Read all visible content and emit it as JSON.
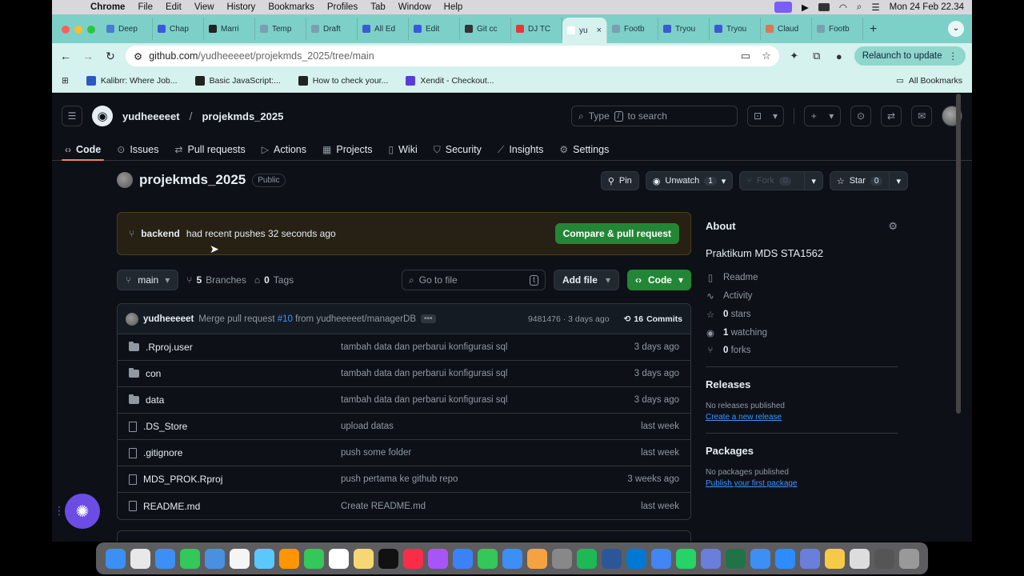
{
  "menubar": {
    "app": "Chrome",
    "items": [
      "File",
      "Edit",
      "View",
      "History",
      "Bookmarks",
      "Profiles",
      "Tab",
      "Window",
      "Help"
    ],
    "clock": "Mon 24 Feb  22.34"
  },
  "tabs": [
    {
      "label": "Deep",
      "color": "#4a7bd5"
    },
    {
      "label": "Chap",
      "color": "#3a5ad5"
    },
    {
      "label": "Marri",
      "color": "#222222"
    },
    {
      "label": "Temp",
      "color": "#7aa0b0"
    },
    {
      "label": "Draft",
      "color": "#7aa0b0"
    },
    {
      "label": "All Ed",
      "color": "#3a5ad5"
    },
    {
      "label": "Edit",
      "color": "#3a5ad5"
    },
    {
      "label": "Git cc",
      "color": "#333333"
    },
    {
      "label": "DJ TC",
      "color": "#e53935"
    },
    {
      "label": "yu",
      "color": "#ffffff",
      "active": true
    },
    {
      "label": "Footb",
      "color": "#7aa0b0"
    },
    {
      "label": "Tryou",
      "color": "#3a5ad5"
    },
    {
      "label": "Tryou",
      "color": "#3a5ad5"
    },
    {
      "label": "Claud",
      "color": "#d97757"
    },
    {
      "label": "Footb",
      "color": "#7aa0b0"
    }
  ],
  "toolbar": {
    "url_host": "github.com",
    "url_path": "/yudheeeeet/projekmds_2025/tree/main",
    "relaunch_label": "Relaunch to update"
  },
  "bookmarks": [
    {
      "label": "Kalibrr: Where Job...",
      "color": "#2b59c3"
    },
    {
      "label": "Basic JavaScript:...",
      "color": "#222222"
    },
    {
      "label": "How to check your...",
      "color": "#222222"
    },
    {
      "label": "Xendit - Checkout...",
      "color": "#5a3dd6"
    }
  ],
  "bookmarks_all": "All Bookmarks",
  "header": {
    "owner": "yudheeeeet",
    "repo": "projekmds_2025",
    "search_placeholder_pre": "Type",
    "search_key": "/",
    "search_placeholder_post": "to search"
  },
  "repo_nav": [
    {
      "label": "Code",
      "icon": "code-icon",
      "glyph": "‹›",
      "active": true
    },
    {
      "label": "Issues",
      "icon": "issue-icon",
      "glyph": "⊙"
    },
    {
      "label": "Pull requests",
      "icon": "pull-request-icon",
      "glyph": "⇄"
    },
    {
      "label": "Actions",
      "icon": "actions-icon",
      "glyph": "▷"
    },
    {
      "label": "Projects",
      "icon": "projects-icon",
      "glyph": "▦"
    },
    {
      "label": "Wiki",
      "icon": "wiki-icon",
      "glyph": "▯"
    },
    {
      "label": "Security",
      "icon": "shield-icon",
      "glyph": "⛉"
    },
    {
      "label": "Insights",
      "icon": "graph-icon",
      "glyph": "⟋"
    },
    {
      "label": "Settings",
      "icon": "gear-icon",
      "glyph": "⚙"
    }
  ],
  "repo": {
    "name": "projekmds_2025",
    "visibility": "Public",
    "pin": "Pin",
    "unwatch": "Unwatch",
    "watch_count": "1",
    "fork": "Fork",
    "fork_count": "0",
    "star": "Star",
    "star_count": "0"
  },
  "banner": {
    "branch": "backend",
    "text": "had recent pushes 32 seconds ago",
    "button": "Compare & pull request"
  },
  "file_nav": {
    "branch": "main",
    "branches_count": "5",
    "branches_label": "Branches",
    "tags_count": "0",
    "tags_label": "Tags",
    "goto_placeholder": "Go to file",
    "goto_key": "t",
    "add_file": "Add file",
    "code": "Code"
  },
  "latest_commit": {
    "author": "yudheeeeet",
    "msg_pre": "Merge pull request",
    "pr": "#10",
    "msg_post": "from yudheeeeet/managerDB",
    "hash_time": "9481476 · 3 days ago",
    "commits_count": "16",
    "commits_label": "Commits"
  },
  "files": [
    {
      "name": ".Rproj.user",
      "type": "folder",
      "message": "tambah data dan perbarui konfigurasi sql",
      "date": "3 days ago"
    },
    {
      "name": "con",
      "type": "folder",
      "message": "tambah data dan perbarui konfigurasi sql",
      "date": "3 days ago"
    },
    {
      "name": "data",
      "type": "folder",
      "message": "tambah data dan perbarui konfigurasi sql",
      "date": "3 days ago"
    },
    {
      "name": ".DS_Store",
      "type": "file",
      "message": "upload datas",
      "date": "last week"
    },
    {
      "name": ".gitignore",
      "type": "file",
      "message": "push some folder",
      "date": "last week"
    },
    {
      "name": "MDS_PROK.Rproj",
      "type": "file",
      "message": "push pertama ke github repo",
      "date": "3 weeks ago"
    },
    {
      "name": "README.md",
      "type": "file",
      "message": "Create README.md",
      "date": "last week"
    }
  ],
  "about": {
    "heading": "About",
    "description": "Praktikum MDS STA1562",
    "readme": "Readme",
    "activity": "Activity",
    "stars_count": "0",
    "stars_label": "stars",
    "watching_count": "1",
    "watching_label": "watching",
    "forks_count": "0",
    "forks_label": "forks"
  },
  "releases": {
    "heading": "Releases",
    "empty": "No releases published",
    "link": "Create a new release"
  },
  "packages": {
    "heading": "Packages",
    "empty": "No packages published",
    "link": "Publish your first package"
  },
  "colors": {
    "accent_green": "#238636",
    "link_blue": "#4493f8",
    "tab_bar": "#7dd0c7",
    "page_bg": "#0d1117"
  }
}
